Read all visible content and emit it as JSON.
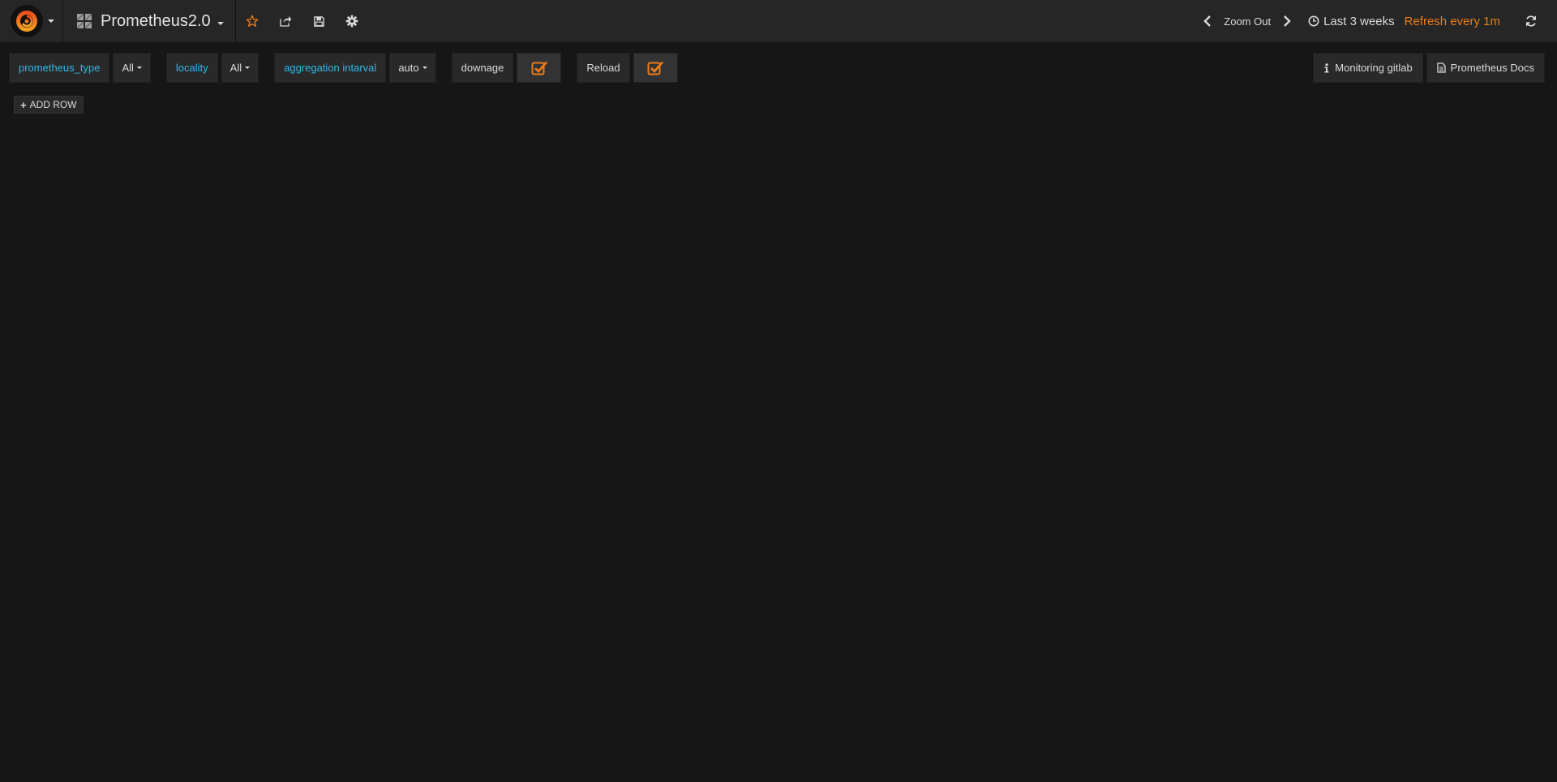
{
  "navbar": {
    "dashboard_title": "Prometheus2.0",
    "zoom_out_label": "Zoom Out",
    "time_range": "Last 3 weeks",
    "refresh_label": "Refresh every 1m"
  },
  "submenu": {
    "variables": [
      {
        "label": "prometheus_type",
        "value": "All"
      },
      {
        "label": "locality",
        "value": "All"
      },
      {
        "label": "aggregation intarval",
        "value": "auto"
      }
    ],
    "downage_label": "downage",
    "reload_label": "Reload"
  },
  "links": {
    "monitoring": "Monitoring gitlab",
    "docs": "Prometheus Docs"
  },
  "add_row_label": "ADD ROW",
  "colors": {
    "accent_orange": "#eb7b18",
    "variable_blue": "#33b5e5",
    "background": "#161616",
    "navbar": "#262626"
  }
}
